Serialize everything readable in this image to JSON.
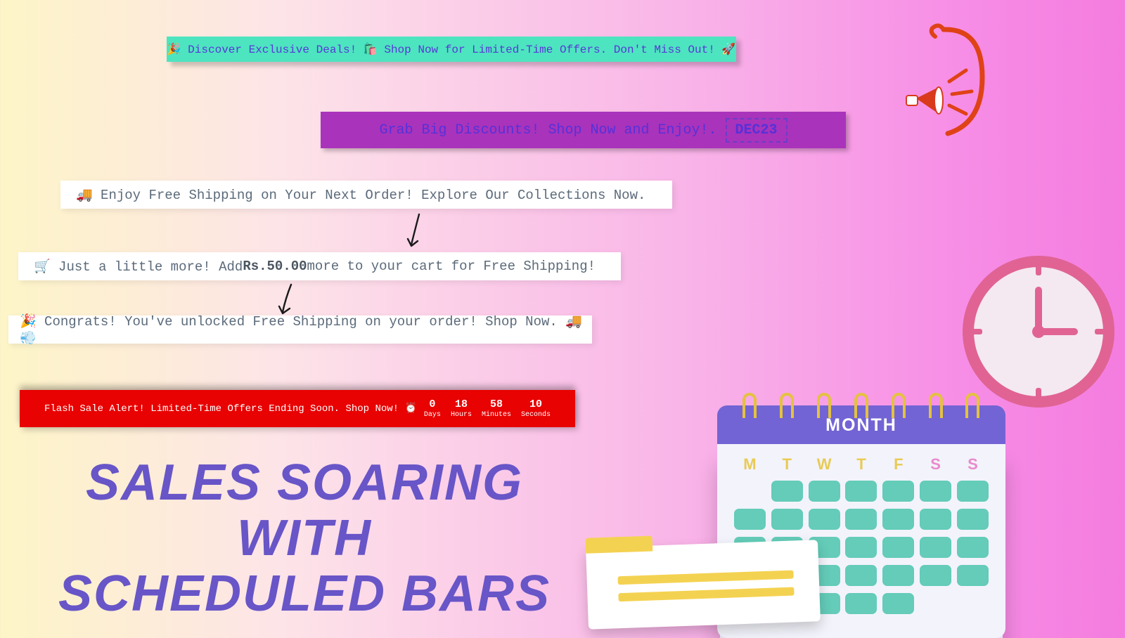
{
  "bar1": {
    "text": "🎉 Discover Exclusive Deals! 🛍️ Shop Now for Limited-Time Offers. Don't Miss Out! 🚀"
  },
  "bar2": {
    "text": "Grab Big Discounts! Shop Now and Enjoy!.",
    "code": "DEC23"
  },
  "bar3": {
    "text": "🚚 Enjoy Free Shipping on Your Next Order! Explore Our Collections Now."
  },
  "bar4": {
    "prefix": "🛒 Just a little more! Add ",
    "amount": "Rs.50.00",
    "suffix": " more to your cart for Free Shipping!"
  },
  "bar5": {
    "text": "🎉 Congrats! You've unlocked Free Shipping on your order! Shop Now. 🚚💨"
  },
  "bar6": {
    "text": "Flash Sale Alert! Limited-Time Offers Ending Soon. Shop Now! ⏰",
    "countdown": {
      "days": {
        "val": "0",
        "lbl": "Days"
      },
      "hours": {
        "val": "18",
        "lbl": "Hours"
      },
      "minutes": {
        "val": "58",
        "lbl": "Minutes"
      },
      "seconds": {
        "val": "10",
        "lbl": "Seconds"
      }
    }
  },
  "headline": {
    "line1": "SALES SOARING WITH",
    "line2": "SCHEDULED BARS"
  },
  "calendar": {
    "title": "MONTH",
    "days": [
      "M",
      "T",
      "W",
      "T",
      "F",
      "S",
      "S"
    ]
  }
}
